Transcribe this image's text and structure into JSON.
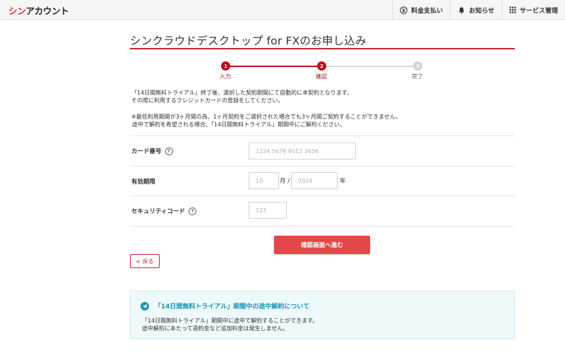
{
  "header": {
    "brand_red": "シン",
    "brand_black": "アカウント",
    "nav": [
      {
        "label": "料金支払い",
        "icon": "yen-circle-icon"
      },
      {
        "label": "お知らせ",
        "icon": "bell-icon"
      },
      {
        "label": "サービス管理",
        "icon": "grid-icon"
      }
    ]
  },
  "page": {
    "title": "シンクラウドデスクトップ for FXのお申し込み"
  },
  "steps": [
    {
      "number": "1",
      "label": "入力",
      "state": "done"
    },
    {
      "number": "2",
      "label": "確認",
      "state": "current"
    },
    {
      "number": "3",
      "label": "完了",
      "state": "pending"
    }
  ],
  "notices": {
    "para1_line1": "「14日間無料トライアル」終了後、選択した契約期間にて自動的に本契約となります。",
    "para1_line2": "その際に利用するクレジットカードの登録をしてください。",
    "para2_line1": "※最低利用期間が3ヶ月間の為、1ヶ月契約をご選択された場合でも3ヶ月間ご契約することができません。",
    "para2_line2": "途中で解約を希望される場合、「14日間無料トライアル」期間中にご解約ください。"
  },
  "form": {
    "card_number": {
      "label": "カード番号",
      "placeholder": "1234 5678 9012 3456",
      "value": ""
    },
    "expiry": {
      "label": "有効期限",
      "month_placeholder": "10",
      "month_unit": "月 /",
      "year_placeholder": "2024",
      "year_unit": "年"
    },
    "security_code": {
      "label": "セキュリティコード",
      "placeholder": "123",
      "value": ""
    },
    "help_glyph": "?"
  },
  "buttons": {
    "confirm": "確認画面へ進む",
    "back": "< 戻る"
  },
  "infobox": {
    "title": "「14日間無料トライアル」期間中の途中解約について",
    "line1": "「14日間無料トライアル」期間中に途中で解約することができます。",
    "line2": "途中解約にあたって違約金など追加料金は発生しません。"
  },
  "colors": {
    "brand_red": "#d6272f",
    "step_red": "#b5121b",
    "button_red": "#e3474a",
    "info_blue": "#1a94b5",
    "info_bg": "#eef9fc"
  }
}
